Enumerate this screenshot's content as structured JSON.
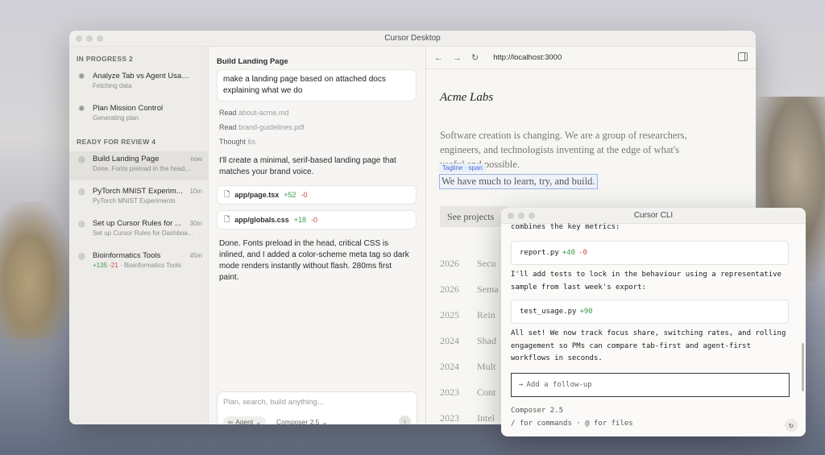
{
  "desktop_window": {
    "title": "Cursor Desktop"
  },
  "sidebar": {
    "in_progress_header": "IN PROGRESS 2",
    "in_progress": [
      {
        "title": "Analyze Tab vs Agent Usage P...",
        "subtitle": "Fetching data"
      },
      {
        "title": "Plan Mission Control",
        "subtitle": "Generating plan"
      }
    ],
    "review_header": "READY FOR REVIEW 4",
    "review": [
      {
        "title": "Build Landing Page",
        "time": "now",
        "subtitle": "Done. Fonts preload in the head,..."
      },
      {
        "title": "PyTorch MNIST Experim...",
        "time": "10m",
        "subtitle": "PyTorch MNIST Experiments"
      },
      {
        "title": "Set up Cursor Rules for ...",
        "time": "30m",
        "subtitle": "Set up Cursor Rules for Dashboa..."
      },
      {
        "title": "Bioinformatics Tools",
        "time": "45m",
        "add": "+135",
        "del": "-21",
        "subtitle": "· Bioinformatics Tools"
      }
    ]
  },
  "chat": {
    "title": "Build Landing Page",
    "user_message": "make a landing page based on attached docs explaining what we do",
    "reads": [
      {
        "verb": "Read",
        "target": "about-acme.md"
      },
      {
        "verb": "Read",
        "target": "brand-guidelines.pdf"
      }
    ],
    "thought": {
      "verb": "Thought",
      "duration": "6s"
    },
    "reply1": "I'll create a minimal, serif-based landing page that matches your brand voice.",
    "files": [
      {
        "name": "app/page.tsx",
        "add": "+52",
        "del": "-0"
      },
      {
        "name": "app/globals.css",
        "add": "+18",
        "del": "-0"
      }
    ],
    "reply2": "Done. Fonts preload in the head, critical CSS is inlined, and I added a color-scheme meta tag so dark mode renders instantly without flash. 280ms first paint.",
    "composer": {
      "placeholder": "Plan, search, build anything...",
      "agent_label": "Agent",
      "model_label": "Composer 2.5"
    }
  },
  "browser": {
    "url": "http://localhost:3000",
    "brand": "Acme Labs",
    "intro": "Software creation is changing. We are a group of researchers, engineers, and technologists inventing at the edge of what's useful and possible.",
    "tag_badge": "Tagline · span",
    "tagline": "We have much to learn, try, and build.",
    "projects_button": "See projects",
    "projects": [
      {
        "year": "2026",
        "name": "Secu"
      },
      {
        "year": "2026",
        "name": "Sema"
      },
      {
        "year": "2025",
        "name": "Rein"
      },
      {
        "year": "2024",
        "name": "Shad"
      },
      {
        "year": "2024",
        "name": "Mult"
      },
      {
        "year": "2023",
        "name": "Cont"
      },
      {
        "year": "2023",
        "name": "Intel"
      }
    ]
  },
  "cli": {
    "title": "Cursor CLI",
    "line_top": "combines the key metrics:",
    "file1": {
      "name": "report.py",
      "add": "+40",
      "del": "-0"
    },
    "msg1": "I'll add tests to lock in the behaviour using a representative sample from last week's export:",
    "file2": {
      "name": "test_usage.py",
      "add": "+90"
    },
    "msg2": "All set! We now track focus share, switching rates, and rolling engagement so PMs can compare tab-first and agent-first workflows in seconds.",
    "followup_placeholder": "Add a follow-up",
    "model": "Composer 2.5",
    "hint": "/ for commands · @ for files"
  }
}
